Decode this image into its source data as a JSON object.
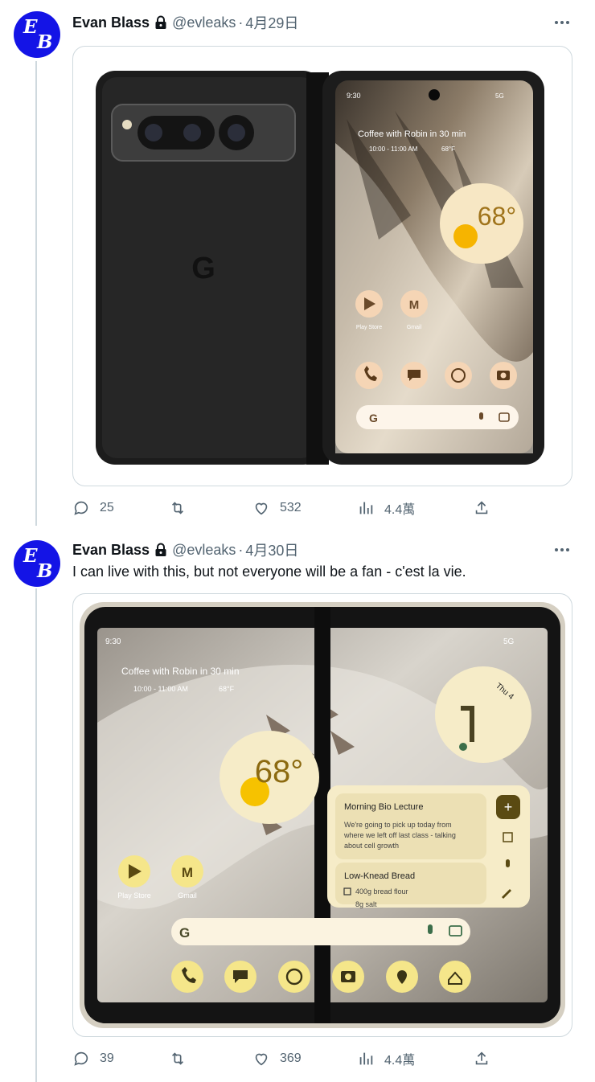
{
  "tweets": [
    {
      "author": {
        "name": "Evan Blass",
        "handle": "@evleaks",
        "avatar_letters": [
          "E",
          "B"
        ]
      },
      "date": "4月29日",
      "text": "",
      "media": {
        "device": "Pixel Fold",
        "outer": {
          "logo": "G"
        },
        "inner_screen": {
          "time": "9:30",
          "status": "5G",
          "event": "Coffee with Robin in 30 min",
          "event_detail": "10:00 - 11:00 AM",
          "event_temp": "68°F",
          "weather_temp": "68°",
          "apps": [
            {
              "label": "Play Store"
            },
            {
              "label": "Gmail"
            }
          ],
          "search_logo": "G"
        }
      },
      "stats": {
        "replies": "25",
        "retweets": "",
        "likes": "532",
        "views": "4.4萬"
      }
    },
    {
      "author": {
        "name": "Evan Blass",
        "handle": "@evleaks",
        "avatar_letters": [
          "E",
          "B"
        ]
      },
      "date": "4月30日",
      "text": "I can live with this, but not everyone will be a fan - c'est la vie.",
      "media": {
        "device": "Pixel Fold",
        "screen": {
          "time": "9:30",
          "status": "5G",
          "event": "Coffee with Robin in 30 min",
          "event_detail": "10:00 - 11:00 AM",
          "event_temp": "68°F",
          "weather_temp": "68°",
          "clock_date": "Thu 4",
          "notes": [
            {
              "title": "Morning Bio Lecture",
              "body": [
                "We're going to pick up today from",
                "where we left off last class - talking",
                "about cell growth"
              ]
            },
            {
              "title": "Low-Knead Bread",
              "items": [
                "400g bread flour",
                "8g salt"
              ]
            }
          ],
          "apps": [
            {
              "label": "Play Store"
            },
            {
              "label": "Gmail"
            }
          ],
          "search_logo": "G"
        }
      },
      "stats": {
        "replies": "39",
        "retweets": "",
        "likes": "369",
        "views": "4.4萬"
      }
    }
  ],
  "colors": {
    "avatar": "#1414e6",
    "muted": "#536471",
    "border": "#cfd9de",
    "widget_cream": "#f7e7c4",
    "widget_yellow": "#f5e68a"
  }
}
